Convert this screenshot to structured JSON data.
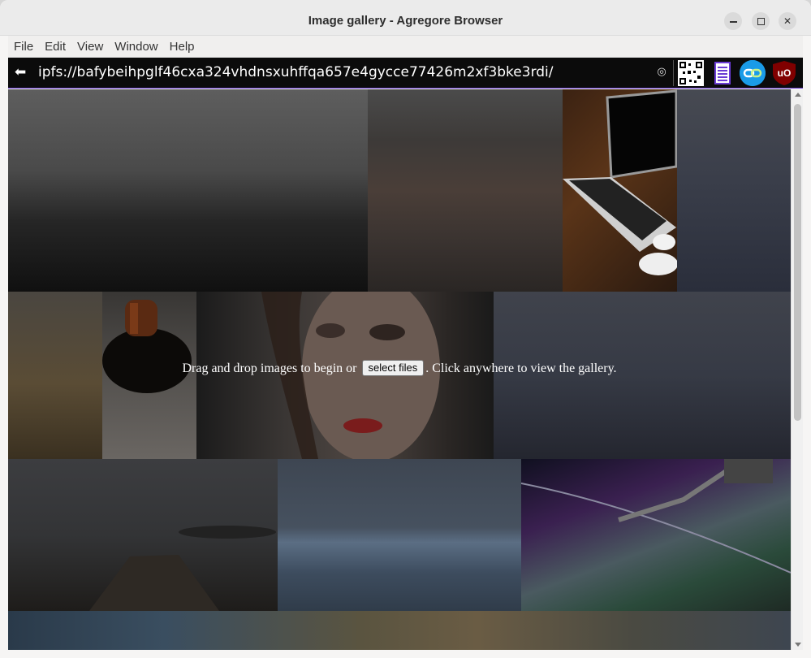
{
  "window": {
    "title": "Image gallery - Agregore Browser",
    "controls": [
      "minimize",
      "maximize",
      "close"
    ]
  },
  "menu": [
    "File",
    "Edit",
    "View",
    "Window",
    "Help"
  ],
  "address": {
    "back_icon": "back-arrow-icon",
    "url": "ipfs://bafybeihpglf46cxa324vhdnsxuhffqa657e4gycce77426m2xf3bke3rdi/",
    "extensions": [
      "qr-code-icon",
      "document-icon",
      "link-icon",
      "ublock-origin-icon"
    ]
  },
  "gallery": {
    "text_before": "Drag and drop images to begin or",
    "button_label": "select files",
    "text_after": ". Click anywhere to view the gallery."
  }
}
